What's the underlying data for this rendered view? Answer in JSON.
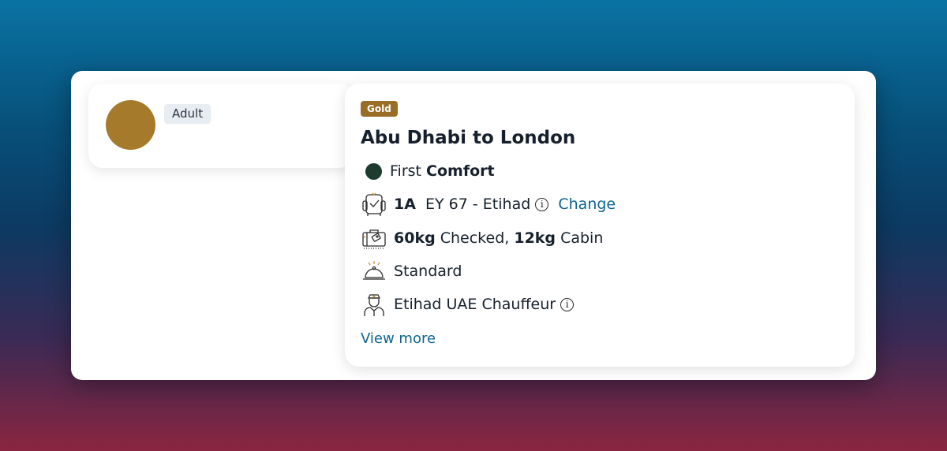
{
  "passenger": {
    "type_label": "Adult",
    "avatar_color": "#a67a2b"
  },
  "flight": {
    "tier_badge": "Gold",
    "route": "Abu Dhabi to London",
    "cabin": {
      "prefix": "First",
      "name": "Comfort",
      "dot_color": "#1d3b2e"
    },
    "seat": {
      "number": "1A",
      "flight_info": "EY 67 - Etihad",
      "change_label": "Change",
      "icon": "seat-icon"
    },
    "baggage": {
      "checked_weight": "60kg",
      "checked_label": "Checked,",
      "cabin_weight": "12kg",
      "cabin_label": "Cabin",
      "icon": "baggage-icon"
    },
    "meal": {
      "label": "Standard",
      "icon": "meal-cloche-icon"
    },
    "chauffeur": {
      "label": "Etihad UAE Chauffeur",
      "icon": "chauffeur-icon"
    },
    "view_more_label": "View more"
  },
  "colors": {
    "accent_link": "#0d6593",
    "gold_badge": "#9a6d27"
  }
}
